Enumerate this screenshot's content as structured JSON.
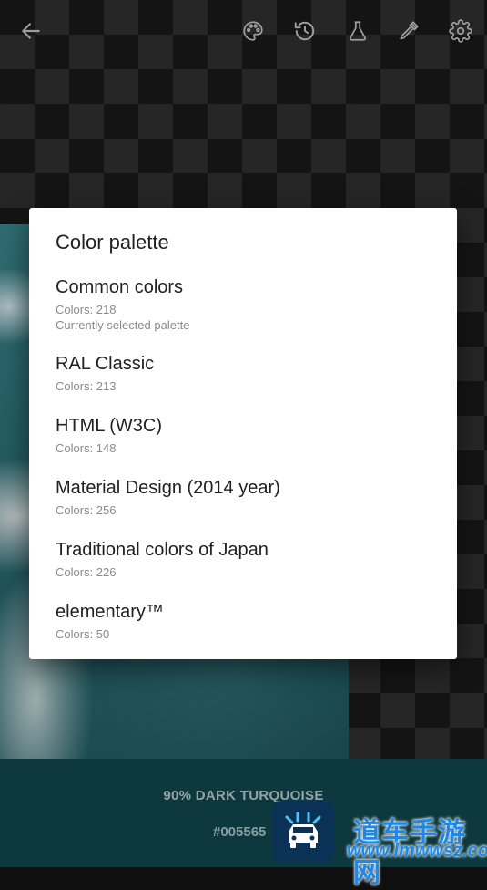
{
  "toolbar": {
    "icons": [
      "back-arrow-icon",
      "palette-icon",
      "history-icon",
      "flask-icon",
      "eyedropper-icon",
      "settings-gear-icon"
    ]
  },
  "dialog": {
    "title": "Color palette",
    "items": [
      {
        "name": "Common colors",
        "count": "Colors: 218",
        "note": "Currently selected palette"
      },
      {
        "name": "RAL Classic",
        "count": "Colors: 213"
      },
      {
        "name": "HTML (W3C)",
        "count": "Colors: 148"
      },
      {
        "name": "Material Design (2014 year)",
        "count": "Colors: 256"
      },
      {
        "name": "Traditional colors of Japan",
        "count": "Colors: 226"
      },
      {
        "name": "elementary™",
        "count": "Colors: 50"
      }
    ]
  },
  "color_info": {
    "name": "90% DARK TURQUOISE",
    "hex": "#005565"
  },
  "watermark": {
    "cn": "道车手游网",
    "url": "www.lmwwsz.com"
  },
  "colors": {
    "strip": "#0d393e",
    "watermark_blue": "#1e88e5"
  }
}
